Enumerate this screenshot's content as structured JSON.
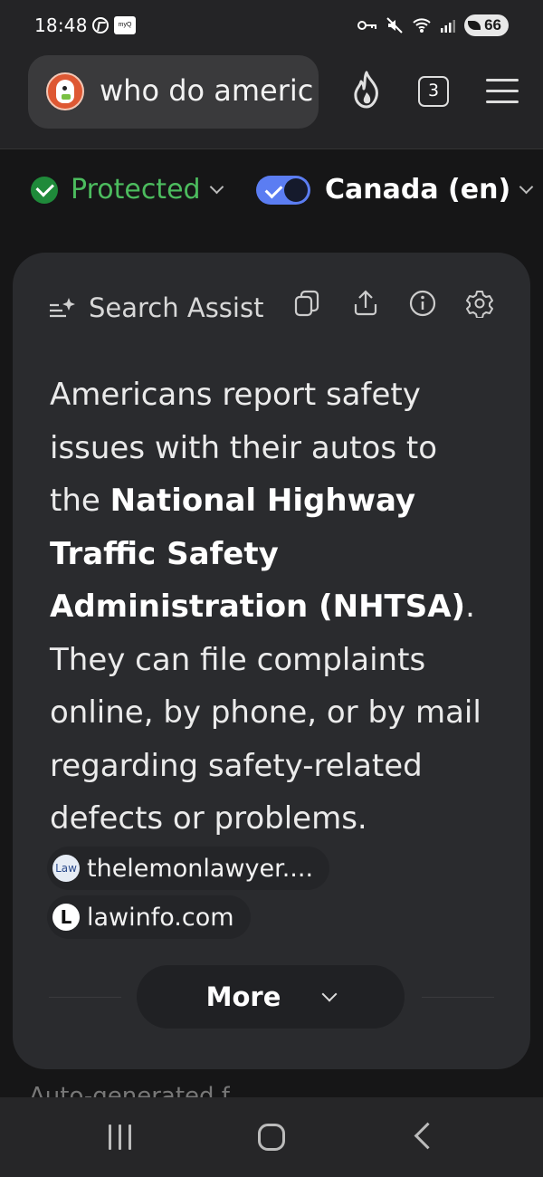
{
  "status_bar": {
    "time": "18:48",
    "icon_label": "myQ",
    "battery": "66"
  },
  "browser": {
    "search_query": "who do americ",
    "tab_count": "3"
  },
  "privacy": {
    "status": "Protected",
    "region": "Canada (en)",
    "region_toggle_on": true
  },
  "assist": {
    "title": "Search Assist",
    "answer": {
      "part1": "Americans report safety issues with their autos to the ",
      "bold": "National Highway Traffic Safety Administration (NHTSA)",
      "part2": ". They can file complaints online, by phone, or by mail regarding safety-related defects or problems."
    },
    "sources": [
      {
        "icon_text": "Law",
        "label": "thelemonlawyer...."
      },
      {
        "icon_text": "L",
        "label": "lawinfo.com"
      }
    ],
    "more_label": "More"
  },
  "peek_text": "Auto-generated f",
  "colors": {
    "accent_blue": "#5b7df2",
    "protected_green": "#4cbc5e",
    "card_bg": "#2a2b2e"
  }
}
